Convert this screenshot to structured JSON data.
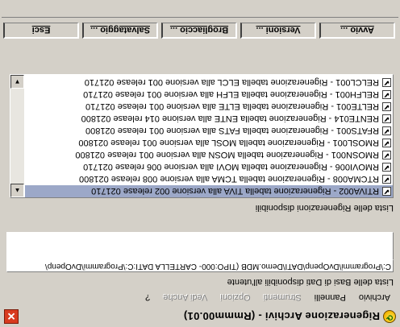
{
  "window": {
    "title": "Rigenerazione Archivi - (Rmmm00.01)",
    "icon": "app-refresh-icon",
    "close_label": "✕"
  },
  "menu": [
    {
      "label": "Archivio",
      "enabled": true
    },
    {
      "label": "Pannelli",
      "enabled": true
    },
    {
      "label": "Strumenti",
      "enabled": false
    },
    {
      "label": "Opzioni",
      "enabled": false
    },
    {
      "label": "Vedi Anche",
      "enabled": false
    },
    {
      "label": "?",
      "enabled": true
    }
  ],
  "bases": {
    "label": "Lista delle Basi di Dati disponibili all'utente",
    "path": "C:\\Programmi\\DvOpenp\\DATI\\Demo.MDB (TIPO:000- CARTELLA DATI:C:\\Programmi\\DvOpenp\\"
  },
  "regen": {
    "label": "Lista delle Rigenerazioni disponibili",
    "items": [
      {
        "text": "RTIVA002 - Rigenerazione tabella TIVA alla versione 002 release 021710",
        "checked": true,
        "selected": true
      },
      {
        "text": "RTCMA008 - Rigenerazione tabella TCMA alla versione 008 release 021800",
        "checked": true,
        "selected": false
      },
      {
        "text": "RMOVI006 - Rigenerazione tabella MOVI alla versione 006 release 021710",
        "checked": true,
        "selected": false
      },
      {
        "text": "RMOSN001 - Rigenerazione tabella MOSN alla versione 001 release 021800",
        "checked": true,
        "selected": false
      },
      {
        "text": "RMOSL001 - Rigenerazione tabella MOSL alla versione 001 release 021800",
        "checked": true,
        "selected": false
      },
      {
        "text": "RFATS001 - Rigenerazione tabella FATS alla versione 001 release 021800",
        "checked": true,
        "selected": false
      },
      {
        "text": "RENTE014 - Rigenerazione tabella ENTE alla versione 014 release 021800",
        "checked": true,
        "selected": false
      },
      {
        "text": "RELTE001 - Rigenerazione tabella ELTE alla versione 001 release 021710",
        "checked": true,
        "selected": false
      },
      {
        "text": "RELFH001 - Rigenerazione tabella ELFH alla versione 001 release 021710",
        "checked": true,
        "selected": false
      },
      {
        "text": "RELCL001 - Rigenerazione tabella ELCL alla versione 001 release 021710",
        "checked": true,
        "selected": false
      }
    ]
  },
  "tabs": [
    {
      "label": "Avvio ..."
    },
    {
      "label": "Versioni ..."
    },
    {
      "label": "Brogliaccio ..."
    },
    {
      "label": "Salvataggio ..."
    },
    {
      "label": "Esci"
    }
  ]
}
